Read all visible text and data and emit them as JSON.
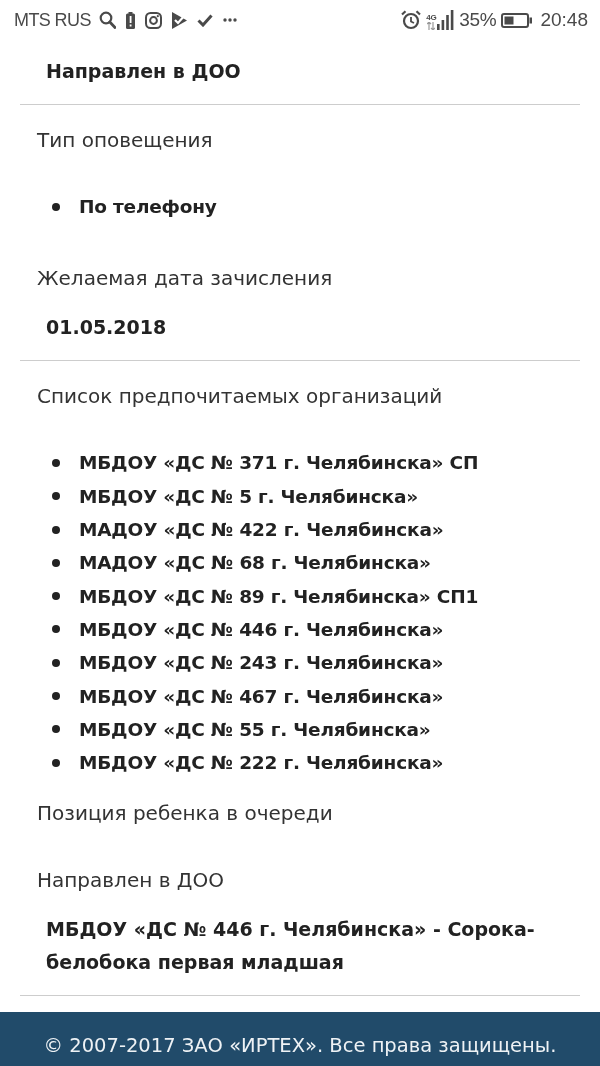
{
  "status_bar": {
    "carrier": "MTS RUS",
    "network": "4G",
    "battery": "35%",
    "time": "20:48"
  },
  "fields": [
    {
      "kind": "text",
      "value": "Направлен в ДОО"
    },
    {
      "kind": "list",
      "label": "Тип оповещения",
      "items": [
        "По телефону"
      ]
    },
    {
      "kind": "text",
      "label": "Желаемая дата зачисления",
      "value": "01.05.2018"
    },
    {
      "kind": "list",
      "label": "Список предпочитаемых организаций",
      "items": [
        "МБДОУ «ДС № 371 г. Челябинска» СП",
        "МБДОУ «ДС № 5 г. Челябинска»",
        "МАДОУ «ДС № 422 г. Челябинска»",
        "МАДОУ «ДС № 68 г. Челябинска»",
        "МБДОУ «ДС № 89 г. Челябинска» СП1",
        "МБДОУ «ДС № 446 г. Челябинска»",
        "МБДОУ «ДС № 243 г. Челябинска»",
        "МБДОУ «ДС № 467 г. Челябинска»",
        "МБДОУ «ДС № 55 г. Челябинска»",
        "МБДОУ «ДС № 222 г. Челябинска»"
      ]
    },
    {
      "kind": "label",
      "label": "Позиция ребенка в очереди"
    },
    {
      "kind": "text",
      "label": "Направлен в ДОО",
      "value": "МБДОУ «ДС № 446 г. Челябинска» - Сорока-белобока первая младшая"
    }
  ],
  "footer": {
    "copyright": "© 2007-2017 ЗАО «ИРТЕХ». Все права защищены."
  }
}
